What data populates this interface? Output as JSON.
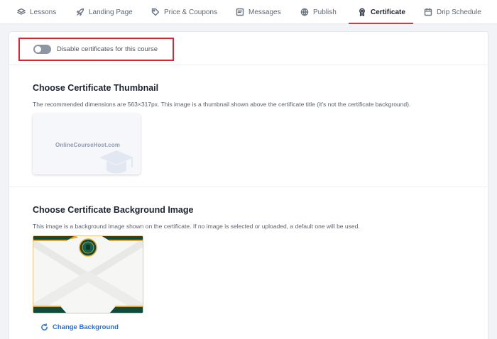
{
  "tabs": [
    {
      "label": "Lessons",
      "icon": "layers-icon"
    },
    {
      "label": "Landing Page",
      "icon": "rocket-icon"
    },
    {
      "label": "Price & Coupons",
      "icon": "tag-icon"
    },
    {
      "label": "Messages",
      "icon": "message-icon"
    },
    {
      "label": "Publish",
      "icon": "globe-icon"
    },
    {
      "label": "Certificate",
      "icon": "award-icon",
      "active": true
    },
    {
      "label": "Drip Schedule",
      "icon": "calendar-icon"
    }
  ],
  "toggle": {
    "label": "Disable certificates for this course",
    "enabled": false
  },
  "thumbnail_section": {
    "title": "Choose Certificate Thumbnail",
    "description": "The recommended dimensions are 563×317px. This image is a thumbnail shown above the certificate title (it's not the certificate background).",
    "logo_text": "OnlineCourseHost.com"
  },
  "background_section": {
    "title": "Choose Certificate Background Image",
    "description": "This image is a background image shown on the certificate. If no image is selected or uploaded, a default one will be used.",
    "change_label": "Change Background"
  },
  "colors": {
    "accent": "#e0323c",
    "link": "#1f6fe5",
    "certificate_green": "#0f4a3a",
    "certificate_gold": "#e0a82e"
  }
}
